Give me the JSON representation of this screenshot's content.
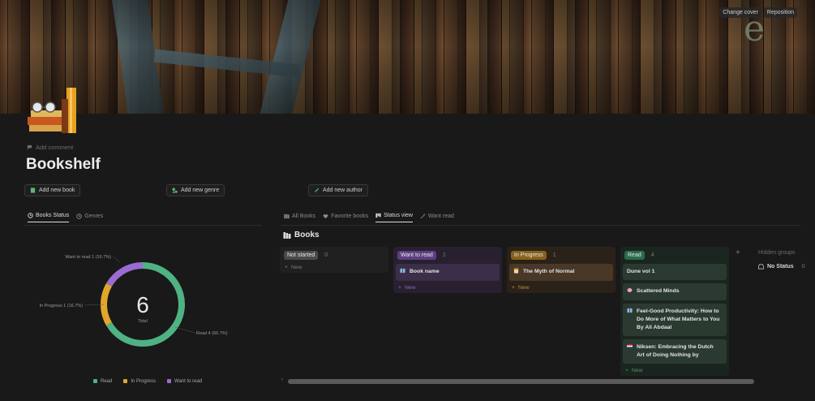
{
  "cover": {
    "change_label": "Change cover",
    "reposition_label": "Reposition",
    "cover_letter": "e"
  },
  "page": {
    "add_comment": "Add comment",
    "title": "Bookshelf"
  },
  "actions": {
    "add_book": "Add new book",
    "add_genre": "Add new genre",
    "add_author": "Add new author"
  },
  "left_tabs": [
    {
      "label": "Books Status",
      "active": true
    },
    {
      "label": "Genres",
      "active": false
    }
  ],
  "right_tabs": [
    {
      "label": "All Books",
      "active": false
    },
    {
      "label": "Favorite books",
      "active": false
    },
    {
      "label": "Status view",
      "active": true
    },
    {
      "label": "Want read",
      "active": false
    }
  ],
  "chart_data": {
    "type": "pie",
    "categories": [
      "Read",
      "In Progress",
      "Want to read"
    ],
    "values": [
      4,
      1,
      1
    ],
    "colors": [
      "#4fb283",
      "#e2a72a",
      "#9a6cd0"
    ],
    "center_value": "6",
    "center_label": "Total",
    "slice_labels": [
      "Read 4 (66.7%)",
      "In Progress 1 (16.7%)",
      "Want to read 1 (16.7%)"
    ],
    "legend": [
      "Read",
      "In Progress",
      "Want to read"
    ],
    "legend_position": "bottom"
  },
  "board": {
    "heading": "Books",
    "columns": [
      {
        "label": "Not started",
        "count": "0",
        "badge_color": "#4a4a4a",
        "bg": "#202020",
        "new_color": "#7a7a7a",
        "cards": []
      },
      {
        "label": "Want to read",
        "count": "1",
        "badge_color": "#5d3f82",
        "bg": "#28202f",
        "new_color": "#8a68b5",
        "card_bg": "#3a2e48",
        "cards": [
          {
            "title": "Book name",
            "icon": "book-icon"
          }
        ]
      },
      {
        "label": "In Progress",
        "count": "1",
        "badge_color": "#87601c",
        "bg": "#2a2218",
        "new_color": "#b88a3a",
        "card_bg": "#493827",
        "cards": [
          {
            "title": "The Myth of Normal",
            "icon": "notebook-icon"
          }
        ]
      },
      {
        "label": "Read",
        "count": "4",
        "badge_color": "#2b6b4b",
        "bg": "#1b2520",
        "new_color": "#4f8d6b",
        "card_bg": "#2a3a31",
        "cards": [
          {
            "title": "Dune vol 1",
            "icon": ""
          },
          {
            "title": "Scattered Minds",
            "icon": "brain-icon"
          },
          {
            "title": "Feel-Good Productivity: How to Do More of What Matters to You By Ali Abdaal",
            "icon": "book-icon"
          },
          {
            "title": "Niksen: Embracing the Dutch Art of Doing Nothing by",
            "icon": "flag-nl-icon"
          }
        ]
      }
    ],
    "new_label": "New",
    "hidden_groups": "Hidden groups",
    "no_status": "No Status",
    "no_status_count": "0"
  }
}
